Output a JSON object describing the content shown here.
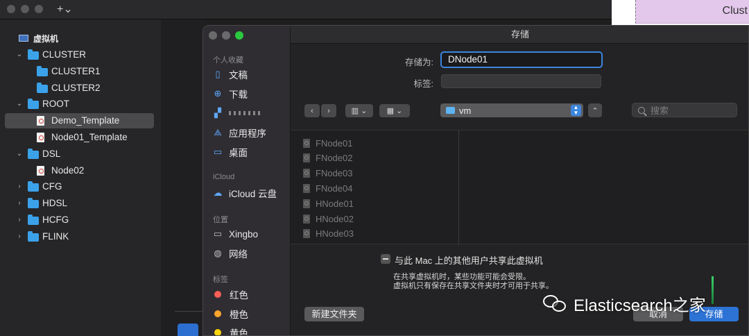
{
  "window": {
    "new_tab_label": "+⌄"
  },
  "right_preview": {
    "card_text": "Clust"
  },
  "sidebar": {
    "root_label": "虚拟机",
    "tree": [
      {
        "label": "CLUSTER",
        "type": "folder",
        "expanded": true,
        "level": 1
      },
      {
        "label": "CLUSTER1",
        "type": "folder",
        "level": 2
      },
      {
        "label": "CLUSTER2",
        "type": "folder",
        "level": 2
      },
      {
        "label": "ROOT",
        "type": "folder",
        "expanded": true,
        "level": 1
      },
      {
        "label": "Demo_Template",
        "type": "vm",
        "level": 2,
        "selected": true
      },
      {
        "label": "Node01_Template",
        "type": "vm",
        "level": 2
      },
      {
        "label": "DSL",
        "type": "folder",
        "expanded": true,
        "level": 1
      },
      {
        "label": "Node02",
        "type": "vm",
        "level": 2
      },
      {
        "label": "CFG",
        "type": "folder",
        "expanded": false,
        "level": 1
      },
      {
        "label": "HDSL",
        "type": "folder",
        "expanded": false,
        "level": 1
      },
      {
        "label": "HCFG",
        "type": "folder",
        "expanded": false,
        "level": 1
      },
      {
        "label": "FLINK",
        "type": "folder",
        "expanded": false,
        "level": 1
      }
    ]
  },
  "dialog": {
    "title": "存储",
    "save_as_label": "存储为:",
    "save_as_value": "DNode01",
    "tags_label": "标签:",
    "location": "vm",
    "search_placeholder": "搜索",
    "sidebar": {
      "favorites_header": "个人收藏",
      "documents": "文稿",
      "downloads": "下载",
      "applications": "应用程序",
      "desktop": "桌面",
      "icloud_header": "iCloud",
      "icloud_drive": "iCloud 云盘",
      "locations_header": "位置",
      "xingbo": "Xingbo",
      "network": "网络",
      "tags_header": "标签",
      "tag_red": "红色",
      "tag_orange": "橙色",
      "tag_yellow": "黄色"
    },
    "files": [
      "FNode01",
      "FNode02",
      "FNode03",
      "FNode04",
      "HNode01",
      "HNode02",
      "HNode03"
    ],
    "share_label": "与此 Mac 上的其他用户共享此虚拟机",
    "share_note_1": "在共享虚拟机时，某些功能可能会受限。",
    "share_note_2": "虚拟机只有保存在共享文件夹时才可用于共享。",
    "new_folder": "新建文件夹",
    "cancel": "取消",
    "save": "存储"
  },
  "watermark": {
    "text": "Elasticsearch之家"
  },
  "colors": {
    "accent": "#2d73d6",
    "folder": "#3ba2ea",
    "tag_red": "#ff5f57",
    "tag_orange": "#ffa52c",
    "tag_yellow": "#ffd60a"
  }
}
